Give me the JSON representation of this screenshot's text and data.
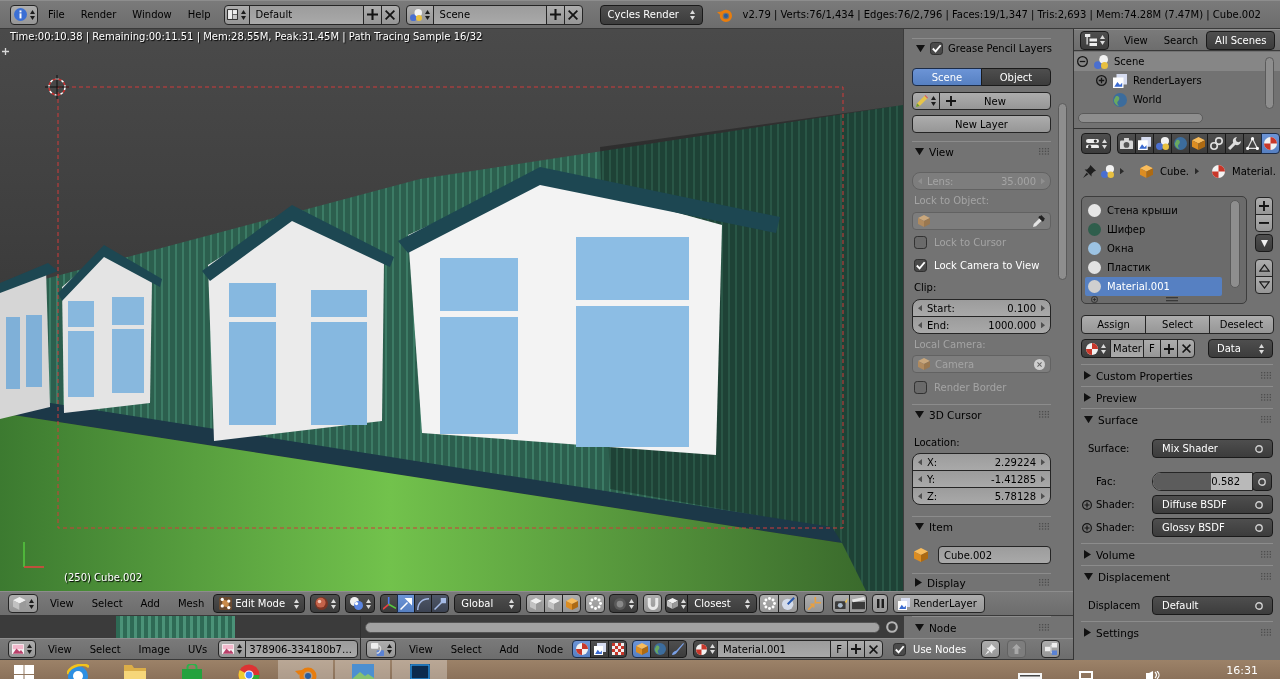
{
  "info_header": {
    "menus": [
      "File",
      "Render",
      "Window",
      "Help"
    ],
    "screen_layout": "Default",
    "scene": "Scene",
    "render_engine": "Cycles Render",
    "stats": "v2.79 | Verts:76/1,434 | Edges:76/2,796 | Faces:19/1,347 | Tris:2,693 | Mem:74.28M (7.47M) | Cube.002"
  },
  "viewport": {
    "render_status": "Time:00:10.38 | Remaining:00:11.51 | Mem:28.55M, Peak:31.45M | Path Tracing Sample 16/32",
    "object_info": "(250) Cube.002"
  },
  "sidebar": {
    "grease_pencil": {
      "title": "Grease Pencil Layers",
      "expanded": true,
      "enabled": true,
      "sources": [
        {
          "label": "Scene",
          "selected": true
        },
        {
          "label": "Object",
          "selected": false
        }
      ],
      "new_button": "New",
      "new_layer_button": "New Layer"
    },
    "view": {
      "title": "View",
      "expanded": true,
      "lens": {
        "label": "Lens:",
        "value": "35.000",
        "disabled": true
      },
      "lock_object": {
        "label": "Lock to Object:",
        "disabled": true
      },
      "lock_to_cursor": {
        "label": "Lock to Cursor",
        "checked": false,
        "disabled": true
      },
      "lock_camera": {
        "label": "Lock Camera to View",
        "checked": true,
        "disabled": false
      },
      "clip_label": "Clip:",
      "clip": [
        {
          "label": "Start:",
          "value": "0.100"
        },
        {
          "label": "End:",
          "value": "1000.000"
        }
      ],
      "local_camera": {
        "label": "Local Camera:",
        "value": "Camera",
        "disabled": true
      },
      "render_border": {
        "label": "Render Border",
        "checked": false,
        "disabled": true
      }
    },
    "cursor": {
      "title": "3D Cursor",
      "expanded": true,
      "location_label": "Location:",
      "location": [
        {
          "label": "X:",
          "value": "2.29224"
        },
        {
          "label": "Y:",
          "value": "-1.41285"
        },
        {
          "label": "Z:",
          "value": "5.78128"
        }
      ]
    },
    "item": {
      "title": "Item",
      "expanded": true,
      "name": "Cube.002"
    },
    "display": {
      "title": "Display",
      "expanded": false
    }
  },
  "view3d_header": {
    "menus": [
      "View",
      "Select",
      "Add",
      "Mesh"
    ],
    "mode": "Edit Mode",
    "transform_tools": [
      {
        "kind": "translate",
        "selected": true
      },
      {
        "kind": "rotate",
        "selected": false
      },
      {
        "kind": "scale",
        "selected": false
      }
    ],
    "orientation": "Global",
    "select_modes": [
      {
        "kind": "vertex"
      },
      {
        "kind": "edge"
      },
      {
        "kind": "face"
      }
    ],
    "snap_target": "Closest",
    "render_layer": "RenderLayer"
  },
  "image_editor": {
    "menus": [
      "View",
      "Select",
      "Image",
      "UVs"
    ],
    "image": "378906-334180b7…"
  },
  "node_editor": {
    "menus": [
      "View",
      "Select",
      "Add",
      "Node"
    ],
    "tree_types": [
      {
        "kind": "shader",
        "selected": true
      },
      {
        "kind": "compositing",
        "selected": false
      },
      {
        "kind": "texture",
        "selected": false
      }
    ],
    "shader_types": [
      {
        "kind": "object",
        "selected": true
      },
      {
        "kind": "world",
        "selected": false
      },
      {
        "kind": "line_style",
        "selected": false
      }
    ],
    "material": "Material.001",
    "fake_user": "F",
    "use_nodes": {
      "label": "Use Nodes",
      "checked": true
    },
    "sidebar_panel": {
      "title": "Node",
      "expanded": true
    }
  },
  "outliner": {
    "menus": [
      "View",
      "Search"
    ],
    "filter": "All Scenes",
    "tree": [
      {
        "label": "Scene",
        "kind": "scene",
        "expanded": true,
        "selected": true,
        "children": [
          {
            "label": "RenderLayers",
            "kind": "render_layers",
            "expanded": false,
            "selected": false
          },
          {
            "label": "World",
            "kind": "world",
            "selected": false
          }
        ]
      }
    ]
  },
  "properties": {
    "tabs": [
      {
        "kind": "render",
        "selected": false
      },
      {
        "kind": "render_layers",
        "selected": false
      },
      {
        "kind": "scene",
        "selected": false
      },
      {
        "kind": "world",
        "selected": false
      },
      {
        "kind": "object",
        "selected": false
      },
      {
        "kind": "constraints",
        "selected": false
      },
      {
        "kind": "modifiers",
        "selected": false
      },
      {
        "kind": "data",
        "selected": false
      },
      {
        "kind": "material",
        "selected": true
      }
    ],
    "breadcrumb": [
      {
        "kind": "object",
        "label": "Cube."
      },
      {
        "kind": "material",
        "label": "Material."
      }
    ],
    "materials": [
      {
        "name": "Стена крыши",
        "color": "#e6e6e6",
        "selected": false
      },
      {
        "name": "Шифер",
        "color": "#2f5e4c",
        "selected": false
      },
      {
        "name": "Окна",
        "color": "#9cc3e3",
        "selected": false
      },
      {
        "name": "Пластик",
        "color": "#e2e2e2",
        "selected": false
      },
      {
        "name": "Material.001",
        "color": "#cfcfcf",
        "selected": true
      }
    ],
    "slot_actions": [
      "Assign",
      "Select",
      "Deselect"
    ],
    "material_name": "Mater",
    "fake_user": "F",
    "link": "Data",
    "panels": [
      {
        "title": "Custom Properties",
        "expanded": false
      },
      {
        "title": "Preview",
        "expanded": false
      },
      {
        "title": "Surface",
        "expanded": true,
        "rows": [
          {
            "kind": "menu",
            "label": "Surface:",
            "value": "Mix Shader"
          },
          {
            "kind": "slider",
            "label": "Fac:",
            "value": "0.582",
            "level": 0.582
          },
          {
            "kind": "input",
            "label": "Shader:",
            "value": "Diffuse BSDF",
            "expanded": false
          },
          {
            "kind": "input",
            "label": "Shader:",
            "value": "Glossy BSDF",
            "expanded": false
          }
        ]
      },
      {
        "title": "Volume",
        "expanded": false
      },
      {
        "title": "Displacement",
        "expanded": true,
        "rows": [
          {
            "kind": "menu",
            "label": "Displacem",
            "value": "Default"
          }
        ]
      },
      {
        "title": "Settings",
        "expanded": false
      }
    ]
  },
  "taskbar": {
    "apps": [
      {
        "kind": "start",
        "open": false
      },
      {
        "kind": "browser",
        "open": false
      },
      {
        "kind": "files",
        "open": false
      },
      {
        "kind": "store",
        "open": false
      },
      {
        "kind": "chrome",
        "open": false
      },
      {
        "kind": "blender",
        "open": true
      },
      {
        "kind": "photos",
        "open": true
      },
      {
        "kind": "photoshop",
        "open": true
      }
    ],
    "clock": "16:31"
  }
}
